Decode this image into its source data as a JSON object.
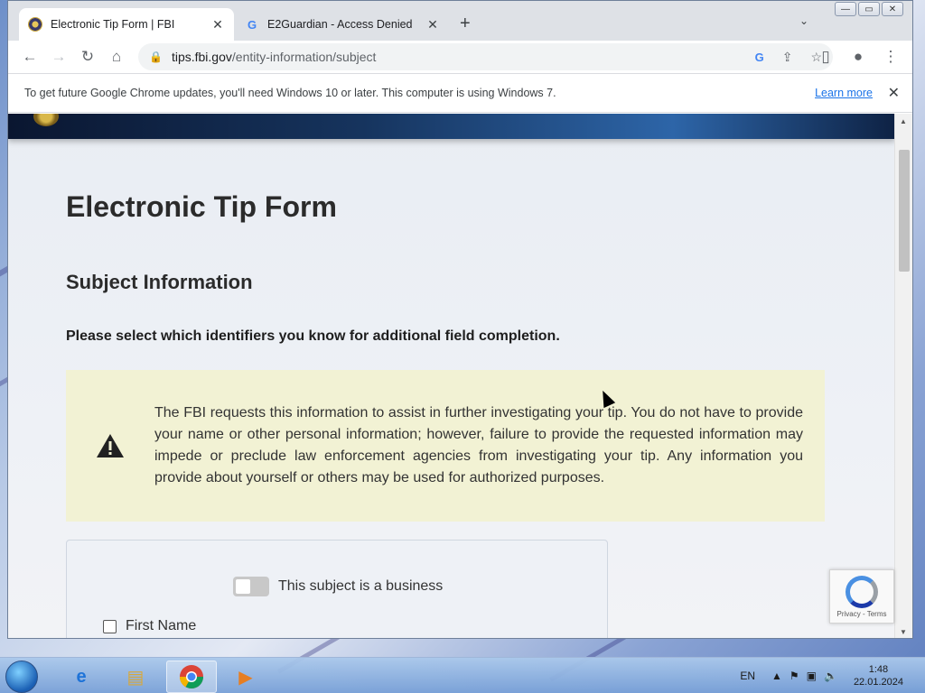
{
  "browser": {
    "tabs": [
      {
        "title": "Electronic Tip Form | FBI",
        "active": true,
        "favicon": "fbi-seal-icon"
      },
      {
        "title": "E2Guardian - Access Denied",
        "active": false,
        "favicon": "google-icon"
      }
    ],
    "address": {
      "host": "tips.fbi.gov",
      "path": "/entity-information/subject"
    },
    "infobar": {
      "message": "To get future Google Chrome updates, you'll need Windows 10 or later. This computer is using Windows 7.",
      "link": "Learn more"
    }
  },
  "page": {
    "title": "Electronic Tip Form",
    "section": "Subject Information",
    "prompt": "Please select which identifiers you know for additional field completion.",
    "warning_text": "The FBI requests this information to assist in further investigating your tip. You do not have to provide your name or other personal information; however, failure to provide the requested information may impede or preclude law enforcement agencies from investigating your tip. Any information you provide about yourself or others may be used for authorized purposes.",
    "business_toggle_label": "This subject is a business",
    "first_name_label": "First Name"
  },
  "recaptcha": {
    "text": "Privacy - Terms"
  },
  "taskbar": {
    "language": "EN",
    "time": "1:48",
    "date": "22.01.2024"
  },
  "colors": {
    "warning_bg": "#f2f2d4",
    "link": "#1a73e8"
  }
}
